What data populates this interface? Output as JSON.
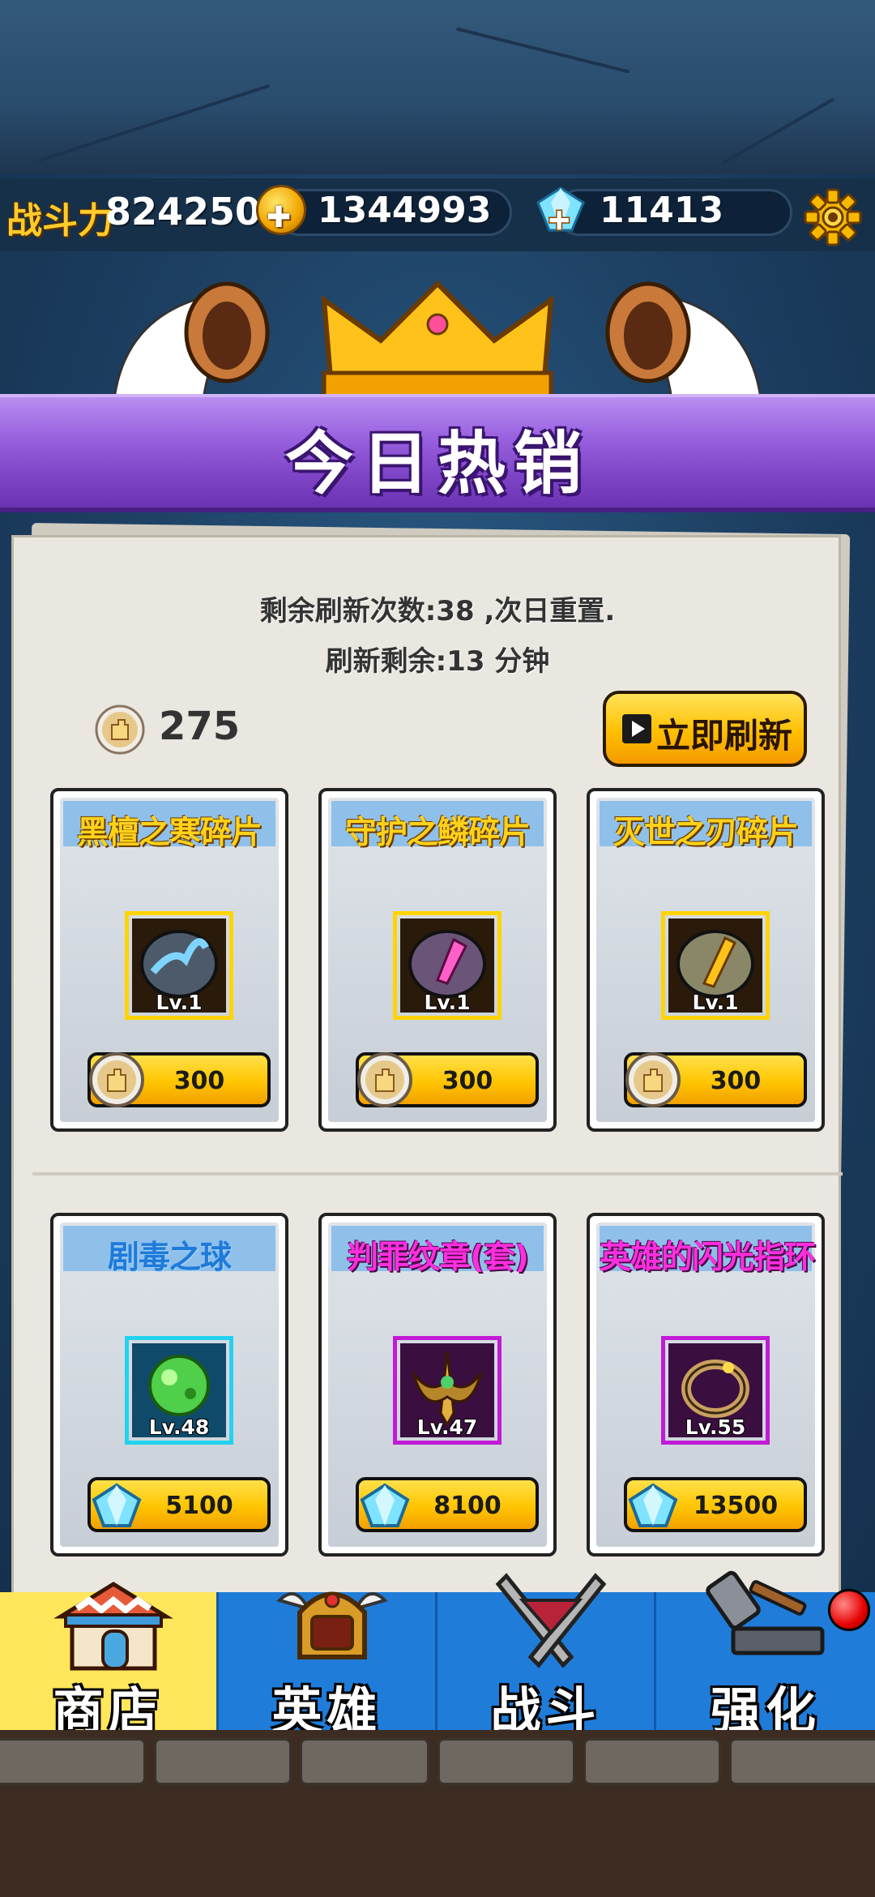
{
  "status": {
    "power_label": "战斗力",
    "power_value": "824250",
    "gold_value": "1344993",
    "gem_value": "11413"
  },
  "banner": {
    "title": "今日热销"
  },
  "shop": {
    "refresh_count_text": "剩余刷新次数:38 ,次日重置.",
    "refresh_timer_text": "刷新剩余:13 分钟",
    "token_count": "275",
    "refresh_now_label": "立即刷新",
    "items": [
      {
        "name": "黑檀之寒碎片",
        "level": "Lv.1",
        "price": "300",
        "currency": "token-icon",
        "frame": "gold",
        "title_style": "gold"
      },
      {
        "name": "守护之鳞碎片",
        "level": "Lv.1",
        "price": "300",
        "currency": "token-icon",
        "frame": "gold",
        "title_style": "gold"
      },
      {
        "name": "灭世之刃碎片",
        "level": "Lv.1",
        "price": "300",
        "currency": "token-icon",
        "frame": "gold",
        "title_style": "gold"
      },
      {
        "name": "剧毒之球",
        "level": "Lv.48",
        "price": "5100",
        "currency": "gem-icon",
        "frame": "cyan",
        "title_style": "blue"
      },
      {
        "name": "判罪纹章(套)",
        "level": "Lv.47",
        "price": "8100",
        "currency": "gem-icon",
        "frame": "purple",
        "title_style": "pink"
      },
      {
        "name": "英雄的闪光指环",
        "level": "Lv.55",
        "price": "13500",
        "currency": "gem-icon",
        "frame": "purple",
        "title_style": "pink"
      }
    ]
  },
  "nav": {
    "tabs": [
      {
        "label": "商店",
        "icon": "shop-icon",
        "active": true
      },
      {
        "label": "英雄",
        "icon": "hero-helmet-icon",
        "active": false
      },
      {
        "label": "战斗",
        "icon": "crossed-swords-icon",
        "active": false
      },
      {
        "label": "强化",
        "icon": "hammer-anvil-icon",
        "active": false
      }
    ]
  },
  "colors": {
    "banner_purple": "#9a63e0",
    "gold": "#ffc500",
    "nav_blue": "#1f7cd9",
    "active_tab": "#ffe65a"
  }
}
